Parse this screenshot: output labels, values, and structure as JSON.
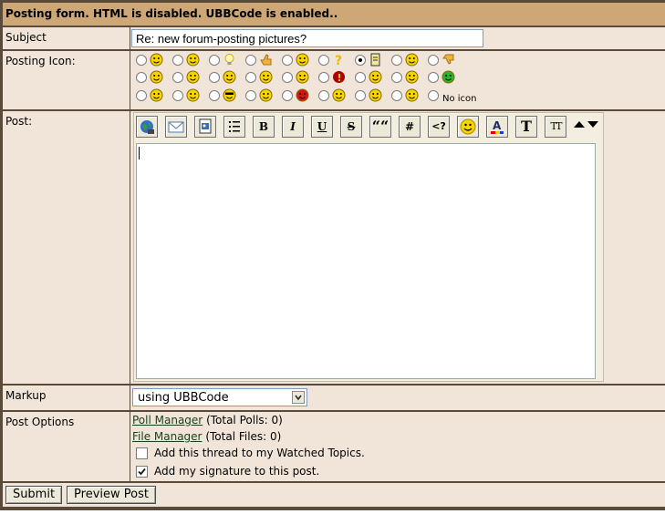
{
  "header": {
    "title": "Posting form. HTML is disabled. UBBCode is enabled.."
  },
  "subject": {
    "label": "Subject",
    "value": "Re: new forum-posting pictures?"
  },
  "posting_icon": {
    "label": "Posting Icon:",
    "no_icon_label": "No icon",
    "selected_index": 6
  },
  "post": {
    "label": "Post:",
    "textarea_value": ""
  },
  "toolbar": {
    "bold": "B",
    "italic": "I",
    "underline": "U",
    "strike": "S",
    "quote": "““",
    "hash": "#",
    "code": "<?",
    "tall_t": "T",
    "small_t": "TT"
  },
  "markup": {
    "label": "Markup",
    "selected": "using UBBCode"
  },
  "post_options": {
    "label": "Post Options",
    "poll_link": "Poll Manager",
    "poll_info": "(Total Polls: 0)",
    "file_link": "File Manager",
    "file_info": "(Total Files: 0)",
    "watch_label": "Add this thread to my Watched Topics.",
    "signature_label": "Add my signature to this post.",
    "watch_checked": false,
    "signature_checked": true
  },
  "buttons": {
    "submit": "Submit",
    "preview": "Preview Post"
  }
}
